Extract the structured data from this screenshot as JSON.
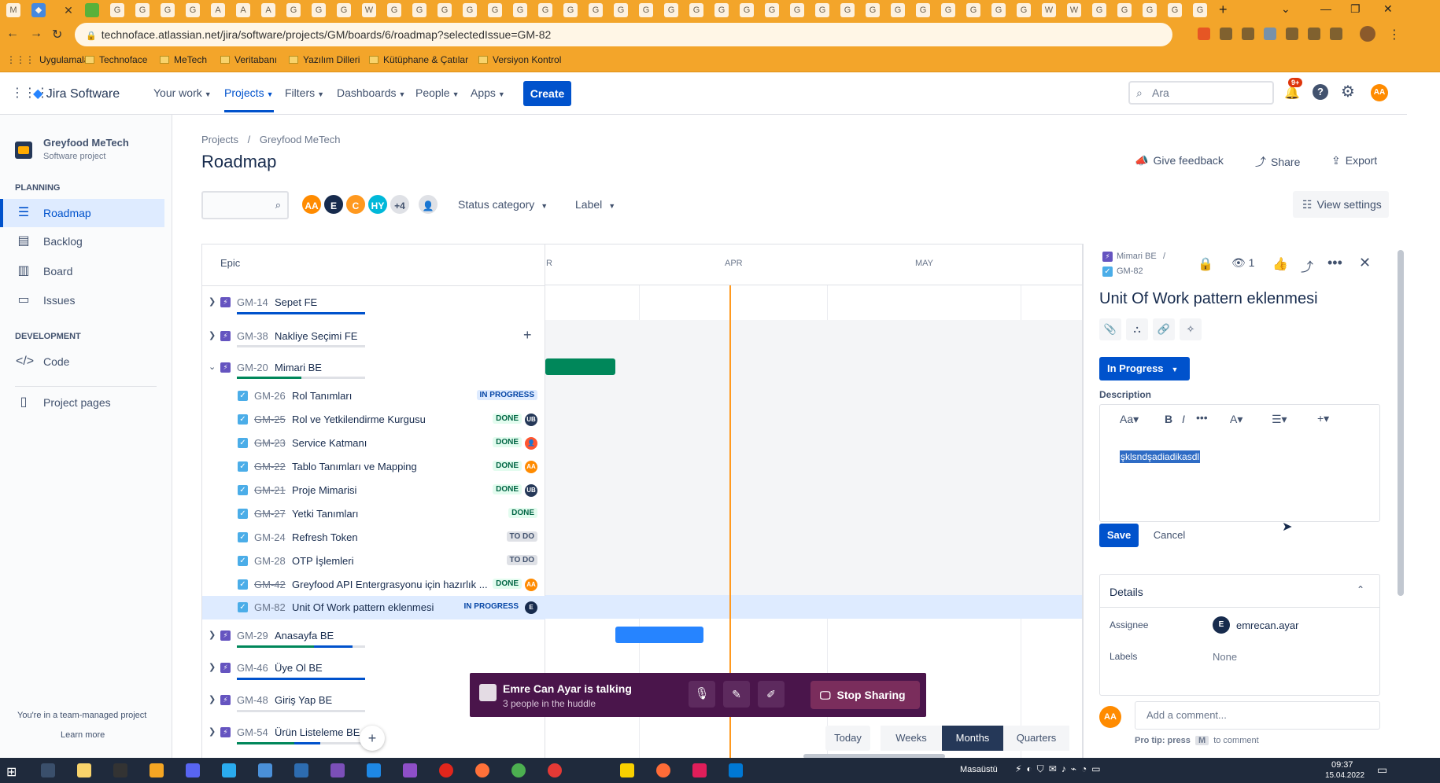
{
  "browser": {
    "url": "technoface.atlassian.net/jira/software/projects/GM/boards/6/roadmap?selectedIssue=GM-82",
    "bookmarks": [
      "Uygulamalar",
      "Technoface",
      "MeTech",
      "Veritabanı",
      "Yazılım Dilleri",
      "Kütüphane & Çatılar",
      "Versiyon Kontrol"
    ]
  },
  "topnav": {
    "product": "Jira Software",
    "items": [
      "Your work",
      "Projects",
      "Filters",
      "Dashboards",
      "People",
      "Apps"
    ],
    "create": "Create",
    "search_placeholder": "Ara",
    "notif_count": "9+",
    "user_initials": "AA"
  },
  "sidebar": {
    "project_name": "Greyfood MeTech",
    "project_type": "Software project",
    "section_planning": "PLANNING",
    "planning_items": [
      "Roadmap",
      "Backlog",
      "Board",
      "Issues"
    ],
    "section_development": "DEVELOPMENT",
    "dev_items": [
      "Code"
    ],
    "project_pages": "Project pages",
    "footer_text": "You're in a team-managed project",
    "learn_more": "Learn more"
  },
  "header": {
    "breadcrumb_projects": "Projects",
    "breadcrumb_sep": "/",
    "breadcrumb_project": "Greyfood MeTech",
    "title": "Roadmap",
    "give_feedback": "Give feedback",
    "share": "Share",
    "export": "Export",
    "view_settings": "View settings",
    "status_category": "Status category",
    "label_filter": "Label",
    "avatars": [
      "AA",
      "E",
      "C",
      "HY"
    ],
    "avatar_more": "+4"
  },
  "roadmap": {
    "epic_header": "Epic",
    "months": [
      "R",
      "APR",
      "MAY"
    ],
    "epics_top": [
      {
        "key": "GM-14",
        "title": "Sepet FE"
      },
      {
        "key": "GM-38",
        "title": "Nakliye Seçimi FE"
      },
      {
        "key": "GM-20",
        "title": "Mimari BE"
      }
    ],
    "children": [
      {
        "key": "GM-26",
        "title": "Rol Tanımları",
        "status": "IN PROGRESS",
        "avatar": ""
      },
      {
        "key": "GM-25",
        "title": "Rol ve Yetkilendirme Kurgusu",
        "status": "DONE",
        "avatar": "UB"
      },
      {
        "key": "GM-23",
        "title": "Service Katmanı",
        "status": "DONE",
        "avatar": ""
      },
      {
        "key": "GM-22",
        "title": "Tablo Tanımları ve Mapping",
        "status": "DONE",
        "avatar": "AA"
      },
      {
        "key": "GM-21",
        "title": "Proje Mimarisi",
        "status": "DONE",
        "avatar": "UB"
      },
      {
        "key": "GM-27",
        "title": "Yetki Tanımları",
        "status": "DONE",
        "avatar": ""
      },
      {
        "key": "GM-24",
        "title": "Refresh Token",
        "status": "TO DO",
        "avatar": ""
      },
      {
        "key": "GM-28",
        "title": "OTP İşlemleri",
        "status": "TO DO",
        "avatar": ""
      },
      {
        "key": "GM-42",
        "title": "Greyfood API Entergrasyonu için hazırlık ...",
        "status": "DONE",
        "avatar": "AA"
      },
      {
        "key": "GM-82",
        "title": "Unit Of Work pattern eklenmesi",
        "status": "IN PROGRESS",
        "avatar": "E"
      }
    ],
    "epics_bottom": [
      {
        "key": "GM-29",
        "title": "Anasayfa BE"
      },
      {
        "key": "GM-46",
        "title": "Üye Ol BE"
      },
      {
        "key": "GM-48",
        "title": "Giriş Yap BE"
      },
      {
        "key": "GM-54",
        "title": "Ürün Listeleme BE"
      }
    ],
    "time_buttons": [
      "Today",
      "Weeks",
      "Months",
      "Quarters"
    ],
    "add_symbol": "+"
  },
  "panel": {
    "parent": "Mimari BE",
    "parent_sep": "/",
    "issue_key": "GM-82",
    "watch_count": "1",
    "title": "Unit Of Work pattern eklenmesi",
    "status": "In Progress",
    "description_label": "Description",
    "description_text": "şklsndşadiadikasdl",
    "save": "Save",
    "cancel": "Cancel",
    "details": "Details",
    "assignee_label": "Assignee",
    "assignee": "emrecan.ayar",
    "assignee_initial": "E",
    "labels_label": "Labels",
    "labels_value": "None",
    "comment_placeholder": "Add a comment...",
    "pro_tip": "Pro tip: press",
    "pro_tip_key": "M",
    "pro_tip_end": "to comment",
    "user_initials": "AA"
  },
  "huddle": {
    "title": "Emre Can Ayar is talking",
    "subtitle": "3 people in the huddle",
    "stop_sharing": "Stop Sharing"
  },
  "taskbar": {
    "desktop_label": "Masaüstü",
    "time": "09:37",
    "date": "15.04.2022"
  }
}
